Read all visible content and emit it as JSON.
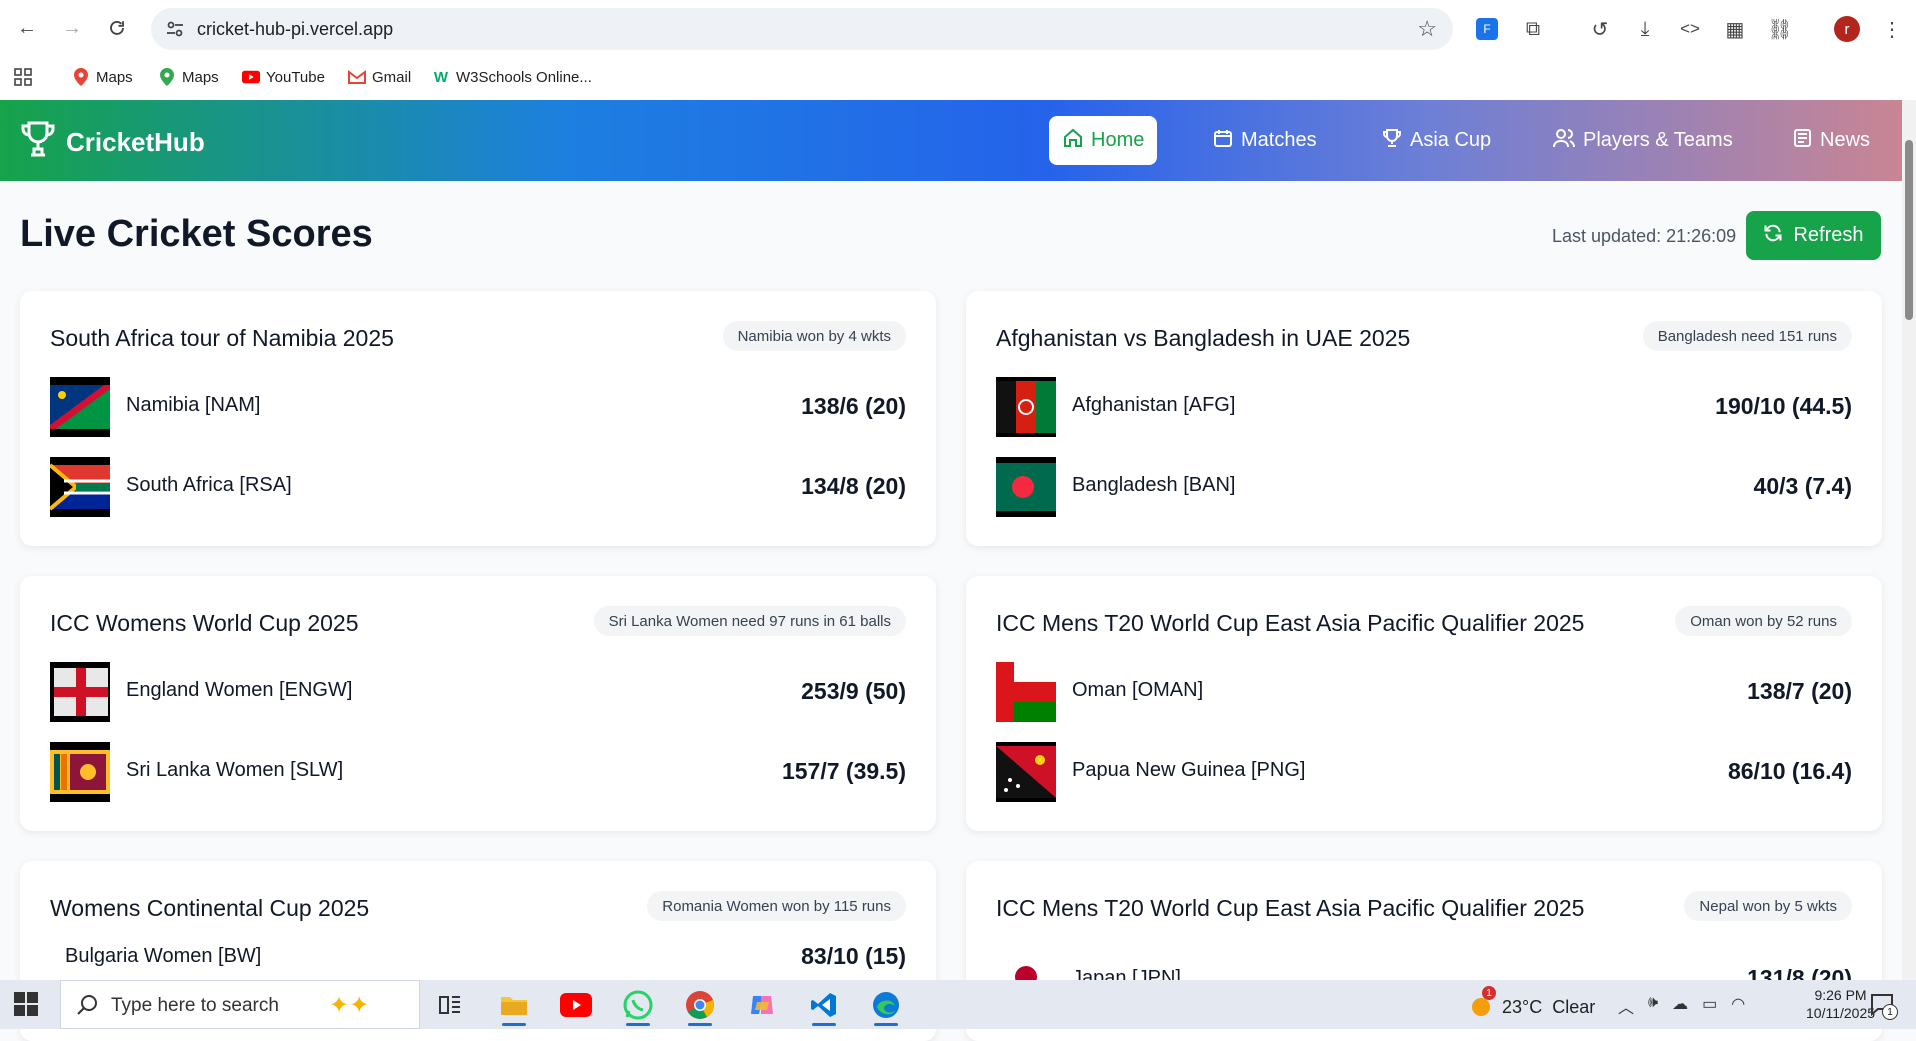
{
  "browser": {
    "url": "cricket-hub-pi.vercel.app",
    "bookmarks": [
      {
        "label": "Maps",
        "icon": "maps-pin-icon"
      },
      {
        "label": "Maps",
        "icon": "maps-pin-icon"
      },
      {
        "label": "YouTube",
        "icon": "youtube-icon"
      },
      {
        "label": "Gmail",
        "icon": "gmail-icon"
      },
      {
        "label": "W3Schools Online...",
        "icon": "w3schools-icon"
      }
    ],
    "profile_initial": "r"
  },
  "app": {
    "brand": "CricketHub",
    "nav": [
      {
        "label": "Home",
        "icon": "home-icon",
        "active": true
      },
      {
        "label": "Matches",
        "icon": "calendar-icon",
        "active": false
      },
      {
        "label": "Asia Cup",
        "icon": "trophy-icon",
        "active": false
      },
      {
        "label": "Players & Teams",
        "icon": "users-icon",
        "active": false
      },
      {
        "label": "News",
        "icon": "newspaper-icon",
        "active": false
      }
    ],
    "colors": {
      "accent": "#16a34a",
      "header_start": "#16a34a",
      "header_mid": "#2563eb",
      "header_end": "#c98593"
    }
  },
  "main": {
    "title": "Live Cricket Scores",
    "last_updated": "Last updated: 21:26:09",
    "refresh_label": "Refresh",
    "matches": [
      {
        "series": "South Africa tour of Namibia 2025",
        "status": "Namibia won by 4 wkts",
        "teams": [
          {
            "name": "Namibia [NAM]",
            "score": "138/6 (20)"
          },
          {
            "name": "South Africa [RSA]",
            "score": "134/8 (20)"
          }
        ]
      },
      {
        "series": "Afghanistan vs Bangladesh in UAE 2025",
        "status": "Bangladesh need 151 runs",
        "teams": [
          {
            "name": "Afghanistan [AFG]",
            "score": "190/10 (44.5)"
          },
          {
            "name": "Bangladesh [BAN]",
            "score": "40/3 (7.4)"
          }
        ]
      },
      {
        "series": "ICC Womens World Cup 2025",
        "status": "Sri Lanka Women need 97 runs in 61 balls",
        "teams": [
          {
            "name": "England Women [ENGW]",
            "score": "253/9 (50)"
          },
          {
            "name": "Sri Lanka Women [SLW]",
            "score": "157/7 (39.5)"
          }
        ]
      },
      {
        "series": "ICC Mens T20 World Cup East Asia Pacific Qualifier 2025",
        "status": "Oman won by 52 runs",
        "teams": [
          {
            "name": "Oman [OMAN]",
            "score": "138/7 (20)"
          },
          {
            "name": "Papua New Guinea [PNG]",
            "score": "86/10 (16.4)"
          }
        ]
      },
      {
        "series": "Womens Continental Cup 2025",
        "status": "Romania Women won by 115 runs",
        "teams": [
          {
            "name": "Bulgaria Women [BW]",
            "score": "83/10 (15)"
          }
        ]
      },
      {
        "series": "ICC Mens T20 World Cup East Asia Pacific Qualifier 2025",
        "status": "Nepal won by 5 wkts",
        "teams": [
          {
            "name": "Japan [JPN]",
            "score": "131/8 (20)"
          }
        ]
      }
    ]
  },
  "taskbar": {
    "search_placeholder": "Type here to search",
    "weather": "23°C  Clear",
    "weather_badge": "1",
    "time": "9:26 PM",
    "date": "10/11/2025",
    "notification_count": "1"
  }
}
